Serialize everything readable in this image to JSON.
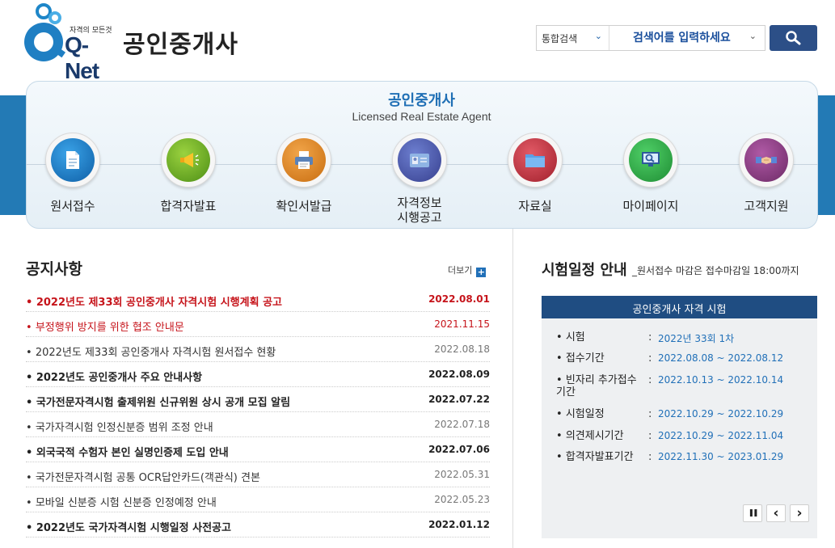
{
  "header": {
    "logo_sub": "자격의 모든것",
    "logo_text": "Q-Net",
    "site_title": "공인중개사",
    "search_scope": "통합검색",
    "search_placeholder": "검색어를 입력하세요"
  },
  "hero": {
    "title": "공인중개사",
    "subtitle": "Licensed Real Estate Agent"
  },
  "menu": [
    {
      "line1": "원서접수",
      "line2": ""
    },
    {
      "line1": "합격자발표",
      "line2": ""
    },
    {
      "line1": "확인서발급",
      "line2": ""
    },
    {
      "line1": "자격정보",
      "line2": "시행공고"
    },
    {
      "line1": "자료실",
      "line2": ""
    },
    {
      "line1": "마이페이지",
      "line2": ""
    },
    {
      "line1": "고객지원",
      "line2": ""
    }
  ],
  "notice": {
    "title": "공지사항",
    "more": "더보기",
    "items": [
      {
        "text": "2022년도 제33회 공인중개사 자격시험 시행계획 공고",
        "date": "2022.08.01"
      },
      {
        "text": "부정행위 방지를 위한 협조 안내문",
        "date": "2021.11.15"
      },
      {
        "text": "2022년도 제33회 공인중개사 자격시험 원서접수 현황",
        "date": "2022.08.18"
      },
      {
        "text": "2022년도 공인중개사 주요 안내사항",
        "date": "2022.08.09"
      },
      {
        "text": "국가전문자격시험 출제위원 신규위원 상시 공개 모집 알림",
        "date": "2022.07.22"
      },
      {
        "text": "국가자격시험 인정신분증 범위 조정 안내",
        "date": "2022.07.18"
      },
      {
        "text": "외국국적 수험자 본인 실명인증제 도입 안내",
        "date": "2022.07.06"
      },
      {
        "text": "국가전문자격시험 공통 OCR답안카드(객관식) 견본",
        "date": "2022.05.31"
      },
      {
        "text": "모바일 신분증 시험 신분증 인정예정 안내",
        "date": "2022.05.23"
      },
      {
        "text": "2022년도 국가자격시험 시행일정 사전공고",
        "date": "2022.01.12"
      }
    ]
  },
  "schedule": {
    "title": "시험일정 안내",
    "subtitle": "_원서접수 마감은 접수마감일 18:00까지",
    "header": "공인중개사 자격 시험",
    "rows": [
      {
        "key": "시험",
        "value": "2022년 33회 1차"
      },
      {
        "key": "접수기간",
        "value": "2022.08.08 ~ 2022.08.12"
      },
      {
        "key": "빈자리 추가접수 기간",
        "value": "2022.10.13 ~ 2022.10.14"
      },
      {
        "key": "시험일정",
        "value": "2022.10.29 ~ 2022.10.29"
      },
      {
        "key": "의견제시기간",
        "value": "2022.10.29 ~ 2022.11.04"
      },
      {
        "key": "합격자발표기간",
        "value": "2022.11.30 ~ 2023.01.29"
      }
    ],
    "controls": {
      "pause": "❚❚",
      "prev": "‹",
      "next": "›"
    }
  },
  "colors": {
    "brand_blue": "#1f6fb5",
    "band_blue": "#237ab5",
    "notice_red": "#c6141b",
    "schedule_header": "#1f4d82"
  }
}
